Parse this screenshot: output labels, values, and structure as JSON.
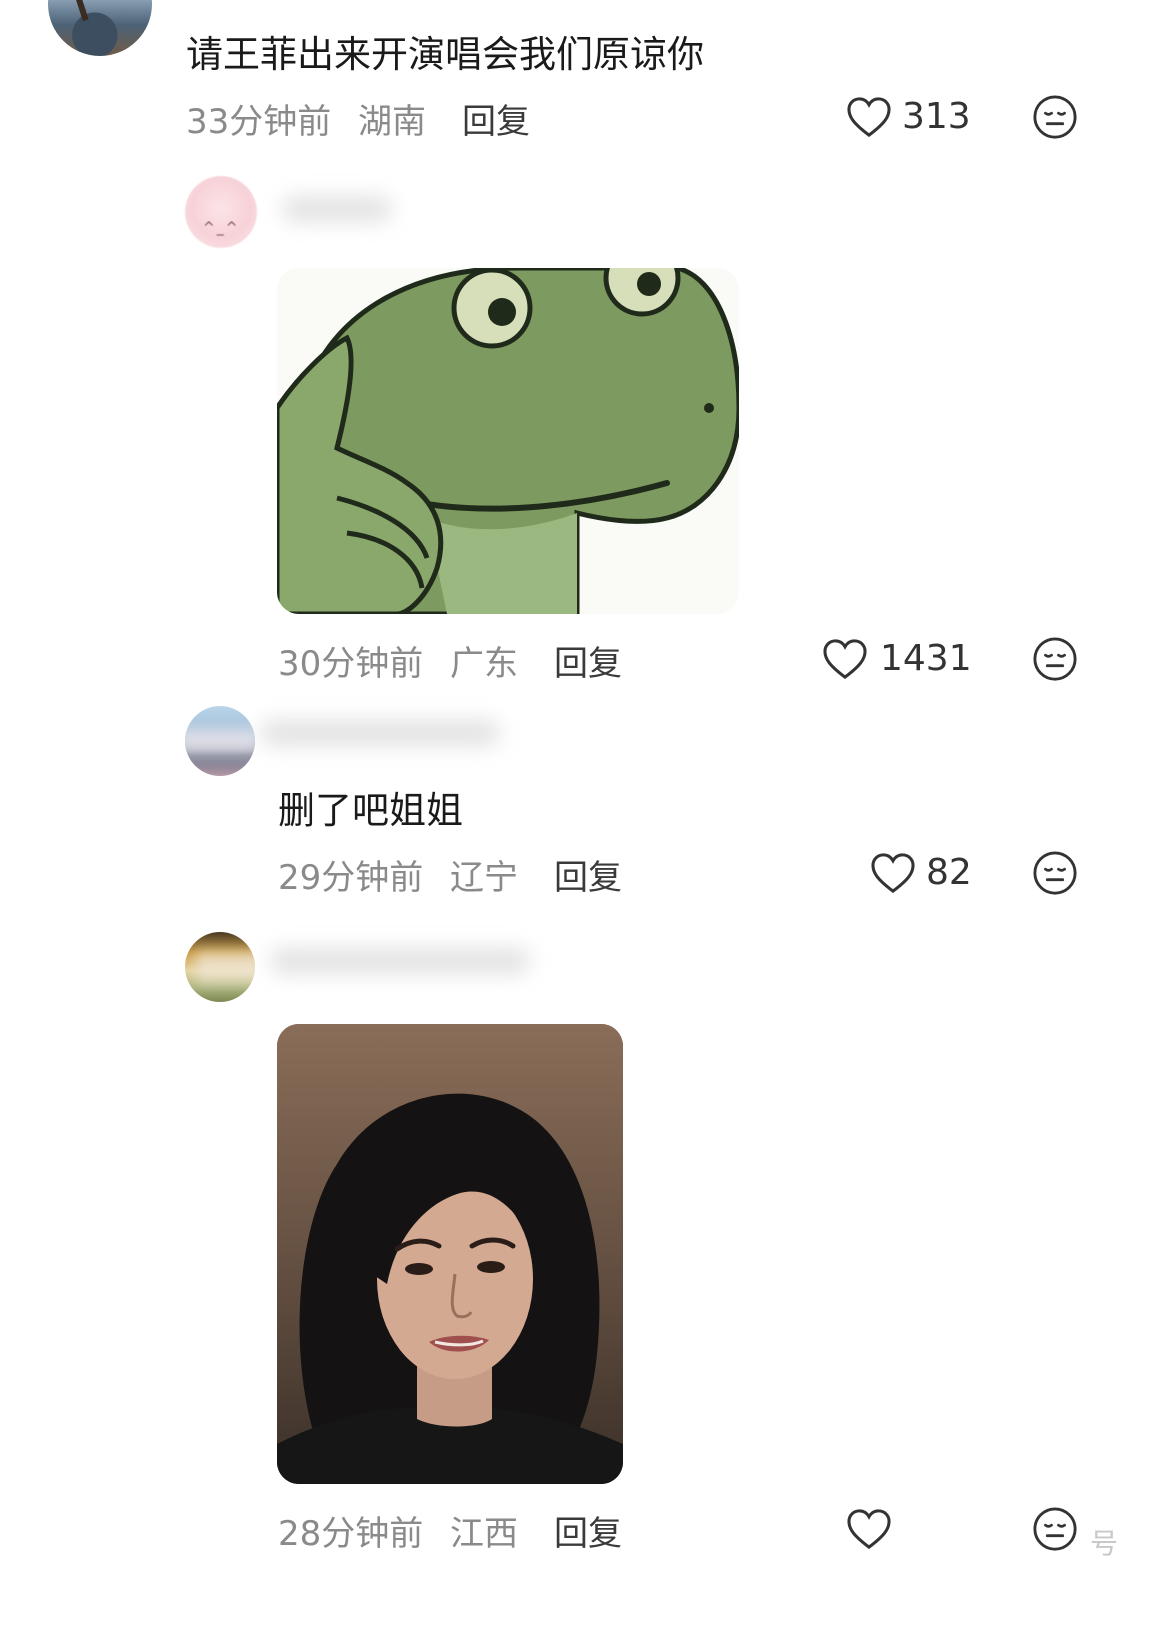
{
  "comments": [
    {
      "text": "请王菲出来开演唱会我们原谅你",
      "time": "33分钟前",
      "location": "湖南",
      "reply_label": "回复",
      "likes": "313",
      "image": null
    },
    {
      "text": "",
      "time": "30分钟前",
      "location": "广东",
      "reply_label": "回复",
      "likes": "1431",
      "image": "frog-sticker"
    },
    {
      "text": "删了吧姐姐",
      "time": "29分钟前",
      "location": "辽宁",
      "reply_label": "回复",
      "likes": "82",
      "image": null
    },
    {
      "text": "",
      "time": "28分钟前",
      "location": "江西",
      "reply_label": "回复",
      "likes": "",
      "image": "woman-portrait"
    }
  ],
  "watermark": "号",
  "colors": {
    "frog_green": "#7c9a5f",
    "meta_gray": "#8a8a8a"
  }
}
